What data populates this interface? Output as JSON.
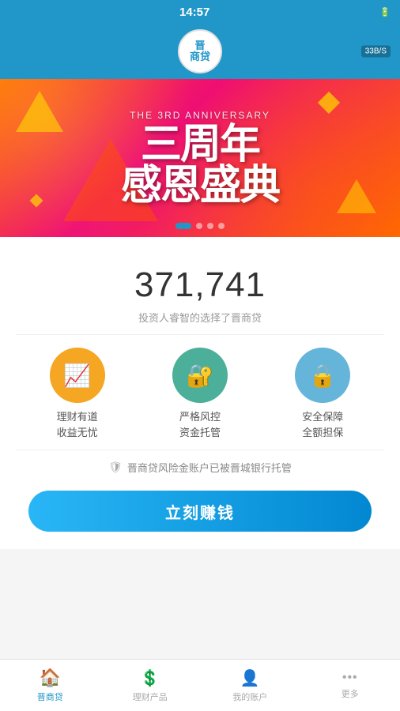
{
  "status_bar": {
    "time": "14:57",
    "wifi_speed": "33B/S",
    "battery_icon": "🔋"
  },
  "header": {
    "logo_text": "晋",
    "logo_subtext": "商贷"
  },
  "banner": {
    "subtitle": "THE 3RD ANNIVERSARY",
    "line1": "三周年",
    "line2": "感恩盛典",
    "dots": [
      true,
      false,
      false,
      false
    ]
  },
  "stats": {
    "number": "371,741",
    "description": "投资人睿智的选择了晋商贷"
  },
  "features": [
    {
      "icon": "📈",
      "line1": "理财有道",
      "line2": "收益无忧",
      "color": "orange"
    },
    {
      "icon": "🔐",
      "line1": "严格风控",
      "line2": "资金托管",
      "color": "teal"
    },
    {
      "icon": "🔒",
      "line1": "安全保障",
      "line2": "全额担保",
      "color": "blue"
    }
  ],
  "trust_badge": {
    "text": "晋商贷风险金账户已被晋城银行托管"
  },
  "cta_button": {
    "label": "立刻赚钱"
  },
  "bottom_nav": [
    {
      "icon": "🏠",
      "label": "晋商贷",
      "active": true
    },
    {
      "icon": "💲",
      "label": "理财产品",
      "active": false
    },
    {
      "icon": "👤",
      "label": "我的账户",
      "active": false
    },
    {
      "icon": "···",
      "label": "更多",
      "active": false
    }
  ]
}
